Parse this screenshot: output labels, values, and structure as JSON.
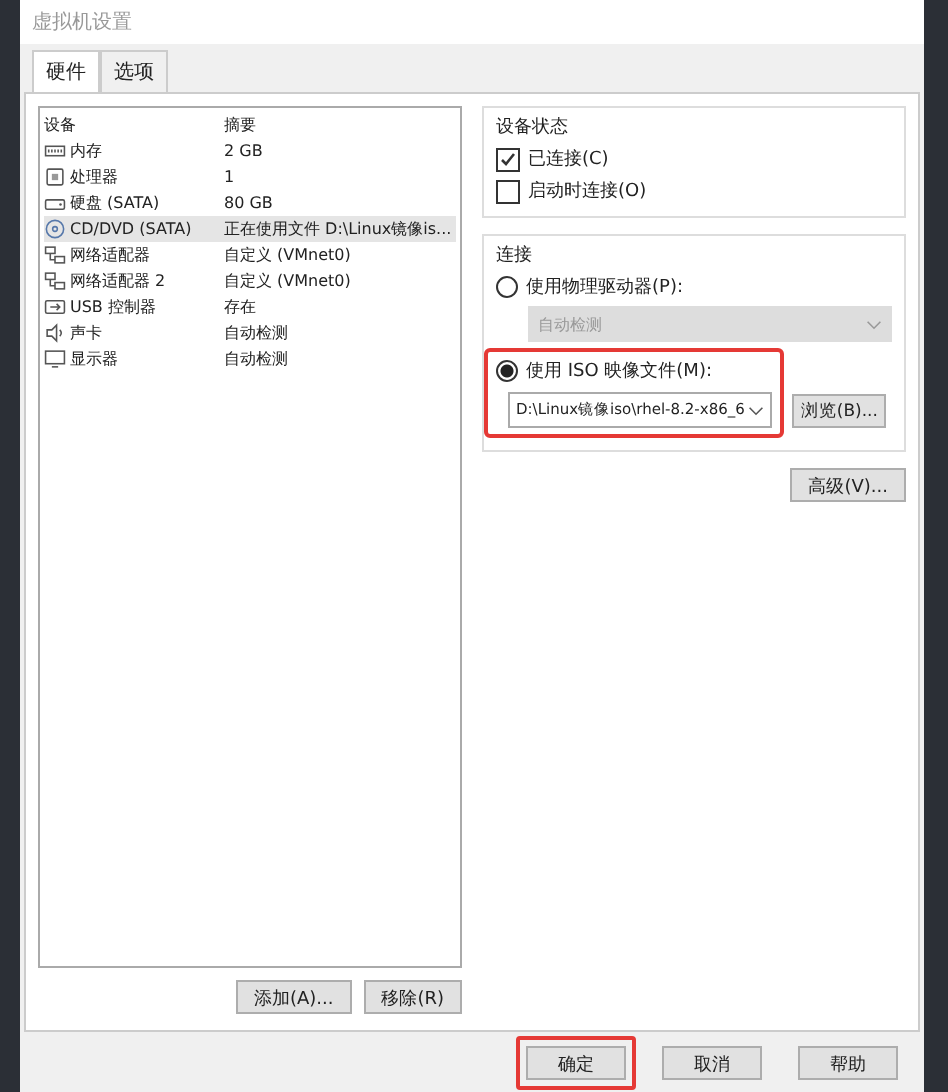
{
  "window": {
    "title": "虚拟机设置"
  },
  "tabs": [
    {
      "label": "硬件",
      "selected": true
    },
    {
      "label": "选项",
      "selected": false
    }
  ],
  "devices": {
    "columns": [
      "设备",
      "摘要"
    ],
    "rows": [
      {
        "kind": "memory",
        "name": "内存",
        "summary": "2 GB",
        "selected": false
      },
      {
        "kind": "cpu",
        "name": "处理器",
        "summary": "1",
        "selected": false
      },
      {
        "kind": "disk",
        "name": "硬盘 (SATA)",
        "summary": "80 GB",
        "selected": false
      },
      {
        "kind": "cdrom",
        "name": "CD/DVD (SATA)",
        "summary": "正在使用文件 D:\\Linux镜像is...",
        "selected": true
      },
      {
        "kind": "network",
        "name": "网络适配器",
        "summary": "自定义 (VMnet0)",
        "selected": false
      },
      {
        "kind": "network",
        "name": "网络适配器 2",
        "summary": "自定义 (VMnet0)",
        "selected": false
      },
      {
        "kind": "usb",
        "name": "USB 控制器",
        "summary": "存在",
        "selected": false
      },
      {
        "kind": "sound",
        "name": "声卡",
        "summary": "自动检测",
        "selected": false
      },
      {
        "kind": "display",
        "name": "显示器",
        "summary": "自动检测",
        "selected": false
      }
    ],
    "buttons": [
      "添加(A)...",
      "移除(R)"
    ]
  },
  "device_status": {
    "title": "设备状态",
    "options": [
      {
        "label": "已连接(C)",
        "checked": true
      },
      {
        "label": "启动时连接(O)",
        "checked": false
      }
    ]
  },
  "connection": {
    "title": "连接",
    "physical": {
      "label": "使用物理驱动器(P):",
      "selected": false,
      "dropdown": "自动检测",
      "disabled": true
    },
    "iso": {
      "label": "使用 ISO 映像文件(M):",
      "selected": true,
      "value": "D:\\Linux镜像iso\\rhel-8.2-x86_6",
      "highlighted": true,
      "browse": "浏览(B)..."
    }
  },
  "advanced_button": "高级(V)...",
  "footer_buttons": [
    {
      "label": "确定",
      "highlighted": true
    },
    {
      "label": "取消",
      "highlighted": false
    },
    {
      "label": "帮助",
      "highlighted": false
    }
  ]
}
